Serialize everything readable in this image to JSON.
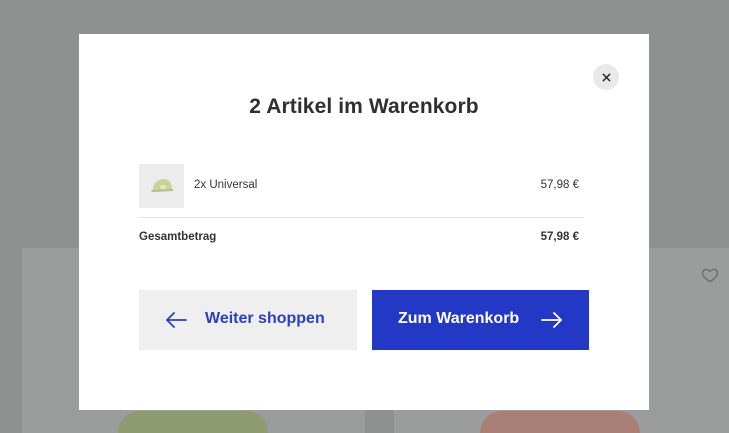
{
  "modal": {
    "title": "2 Artikel im Warenkorb",
    "close_icon": "close-icon",
    "items": [
      {
        "label": "2x Universal",
        "price": "57,98 €",
        "thumbnail_icon": "cap-thumbnail"
      }
    ],
    "total": {
      "label": "Gesamtbetrag",
      "value": "57,98 €"
    },
    "buttons": {
      "continue_label": "Weiter shoppen",
      "continue_icon": "arrow-left-icon",
      "cart_label": "Zum Warenkorb",
      "cart_icon": "arrow-right-icon"
    }
  },
  "background": {
    "favorite_icon": "heart-icon"
  },
  "colors": {
    "accent": "#2338c4",
    "overlay": "#8f9090",
    "secondary_button": "#efefef"
  }
}
